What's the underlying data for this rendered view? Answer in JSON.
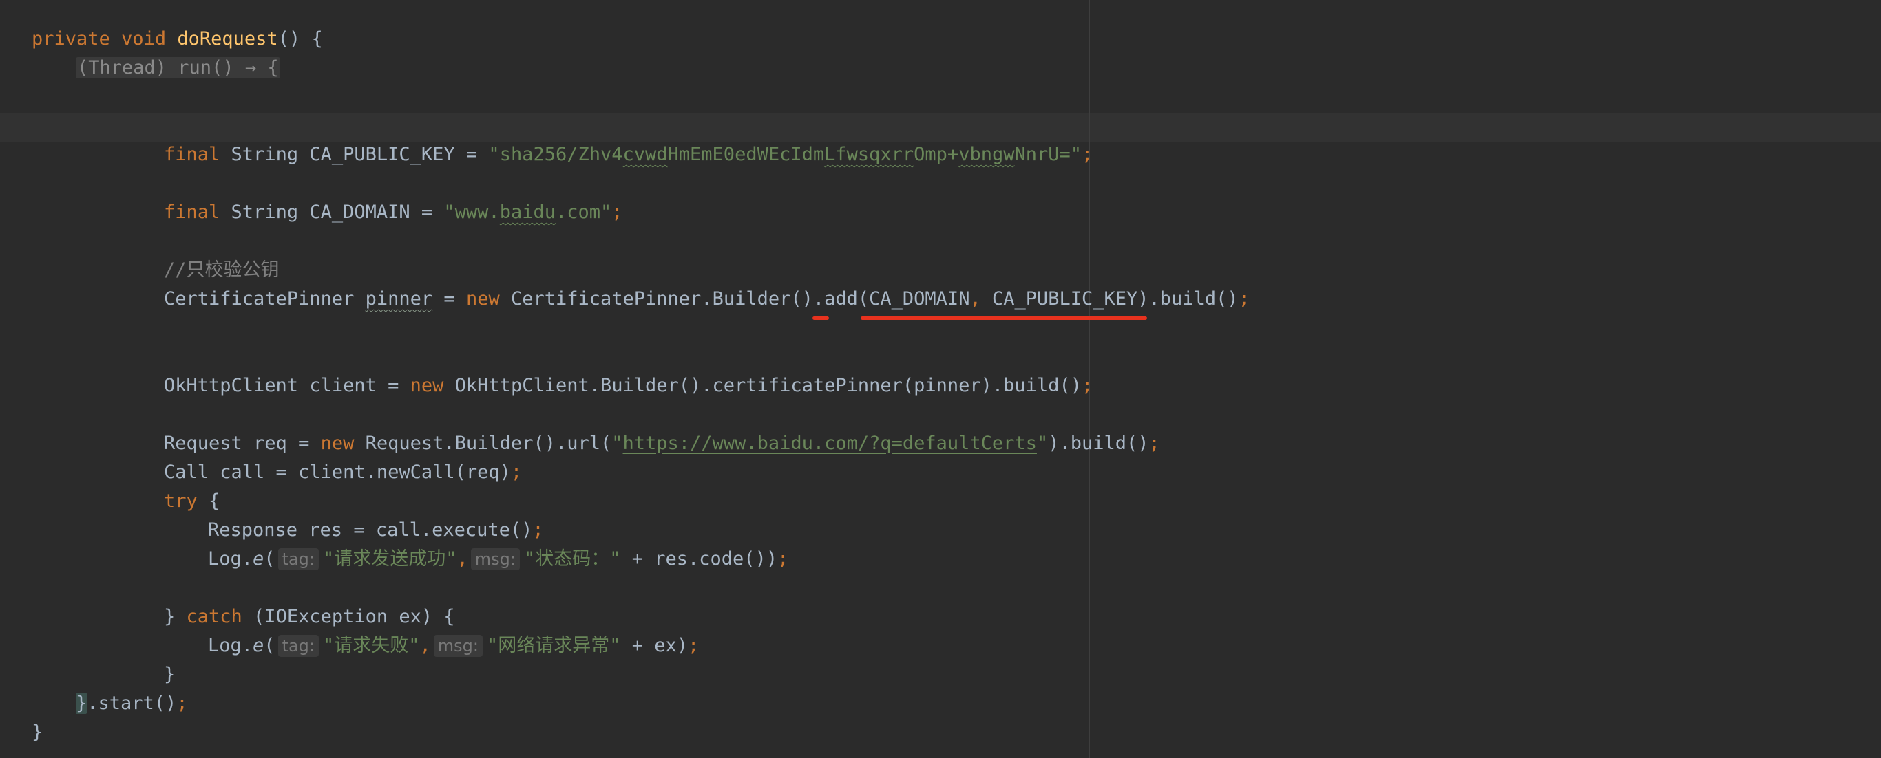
{
  "code": {
    "l1": {
      "kw1": "private",
      "kw2": "void",
      "method": "doRequest",
      "rest": "() {"
    },
    "l2": {
      "fold": "(Thread) run() → {"
    },
    "l3": {
      "kw": "final",
      "type": "String CA_PUBLIC_KEY = ",
      "q1": "\"",
      "s1": "sha256/Zhv4",
      "s2": "cvwd",
      "s3": "HmEmE0edWEcIdm",
      "s4": "Lfwsqxrr",
      "s5": "Omp+",
      "s6": "vbngw",
      "s7": "NnrU=",
      "q2": "\"",
      "semi": ";"
    },
    "l4": {
      "kw": "final",
      "type": "String CA_DOMAIN = ",
      "s1": "\"www.",
      "s2": "baidu",
      "s3": ".com\"",
      "semi": ";"
    },
    "l5": {
      "comment": "//只校验公钥"
    },
    "l6": {
      "p1": "CertificatePinner ",
      "var": "pinner",
      "p2": " = ",
      "kw": "new",
      "p3": " CertificatePinner.Builder().add(CA_DOMAIN",
      "comma": ",",
      "p4": " CA_PUBLIC_KEY).build()",
      "semi": ";"
    },
    "l7": {
      "p1": "OkHttpClient client = ",
      "kw": "new",
      "p2": " OkHttpClient.Builder().certificatePinner(pinner).build()",
      "semi": ";"
    },
    "l8": {
      "p1": "Request req = ",
      "kw": "new",
      "p2": " Request.Builder().url(",
      "q1": "\"",
      "url": "https://www.baidu.com/?q=defaultCerts",
      "q2": "\"",
      "p3": ").build()",
      "semi": ";"
    },
    "l9": {
      "p1": "Call call = client.newCall(req)",
      "semi": ";"
    },
    "l10": {
      "kw": "try",
      "p1": " {"
    },
    "l11": {
      "p1": "Response res = call.execute()",
      "semi": ";"
    },
    "l12": {
      "p1": "Log.",
      "m": "e",
      "p2": "(",
      "hint1": "tag:",
      "s1": "\"请求发送成功\"",
      "comma": ",",
      "hint2": "msg:",
      "s2": "\"状态码：\"",
      "p3": " + res.code())",
      "semi": ";"
    },
    "l13": {
      "p1": "} ",
      "kw": "catch",
      "p2": " (IOException ex) {"
    },
    "l14": {
      "p1": "Log.",
      "m": "e",
      "p2": "(",
      "hint1": "tag:",
      "s1": "\"请求失败\"",
      "comma": ",",
      "hint2": "msg:",
      "s2": "\"网络请求异常\"",
      "p3": " + ex)",
      "semi": ";"
    },
    "l15": {
      "p1": "}"
    },
    "l16": {
      "brace": "}",
      "p1": ".start()",
      "semi": ";"
    },
    "l17": {
      "p1": "}"
    }
  },
  "colors": {
    "background": "#2b2b2b",
    "keyword": "#cc7832",
    "method_decl": "#ffc66d",
    "string": "#6a8759",
    "comment": "#808080",
    "plain": "#a9b7c6",
    "annotation_red": "#e8321e"
  }
}
